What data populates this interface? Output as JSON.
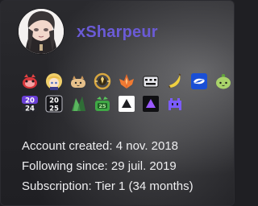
{
  "user": {
    "username": "xSharpeur"
  },
  "badges": {
    "row1": [
      {
        "icon": "red-heart-creature-icon"
      },
      {
        "icon": "blonde-character-icon"
      },
      {
        "icon": "bread-creature-icon"
      },
      {
        "icon": "gold-ring-icon"
      },
      {
        "icon": "orange-lotus-icon"
      },
      {
        "icon": "keyboard-icon"
      },
      {
        "icon": "banana-icon"
      },
      {
        "icon": "blue-logo-icon"
      },
      {
        "icon": "green-leaf-creature-icon"
      }
    ],
    "row2": [
      {
        "icon": "year-2024-badge-icon",
        "text_top": "20",
        "text_bottom": "24"
      },
      {
        "icon": "year-2025-badge-icon",
        "text_top": "20",
        "text_bottom": "25"
      },
      {
        "icon": "green-crystal-icon"
      },
      {
        "icon": "green-gem-badge-icon",
        "text": "25"
      },
      {
        "icon": "white-triangle-icon"
      },
      {
        "icon": "purple-triangle-icon"
      },
      {
        "icon": "purple-bits-icon"
      }
    ]
  },
  "colors": {
    "username": "#6b5bd6",
    "info_text": "#efeff1"
  },
  "info": {
    "account_created": "Account created: 4 nov. 2018",
    "following_since": "Following since: 29 juil. 2019",
    "subscription": "Subscription: Tier 1 (34 months)"
  }
}
